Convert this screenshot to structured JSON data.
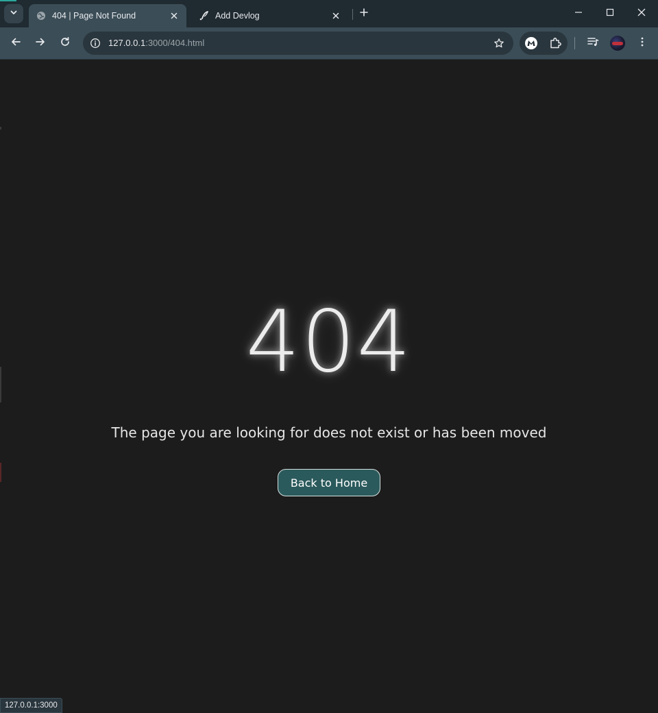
{
  "browser": {
    "tabs": [
      {
        "title": "404 | Page Not Found",
        "active": true,
        "favicon": "globe-icon"
      },
      {
        "title": "Add Devlog",
        "active": false,
        "favicon": "quill-icon"
      }
    ],
    "address_bar": {
      "host": "127.0.0.1",
      "path": ":3000/404.html"
    },
    "status_url": "127.0.0.1:3000",
    "icons": {
      "tab_search": "chevron-down-icon",
      "new_tab": "plus-icon",
      "minimize": "minimize-icon",
      "maximize": "maximize-icon",
      "close": "close-icon",
      "back": "back-arrow-icon",
      "forward": "forward-arrow-icon",
      "reload": "reload-icon",
      "site_info": "info-icon",
      "bookmark": "star-icon",
      "malwarebytes": "malwarebytes-icon",
      "extensions": "puzzle-icon",
      "media_control": "media-queue-icon",
      "profile": "avatar",
      "menu": "kebab-menu-icon"
    }
  },
  "page": {
    "error_code": "404",
    "message": "The page you are looking for does not exist or has been moved",
    "home_button_label": "Back to Home",
    "colors": {
      "background": "#1c1c1c",
      "button_fill": "#2b5a5c",
      "text": "#ececec"
    }
  }
}
